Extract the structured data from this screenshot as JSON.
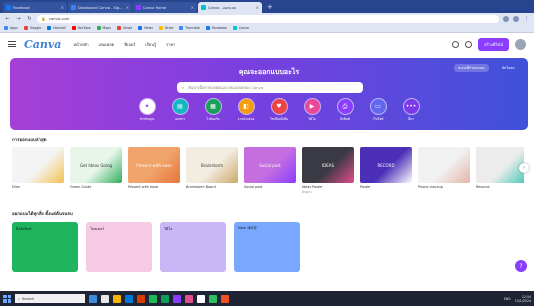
{
  "browser": {
    "tabs": [
      {
        "label": "Facebook",
        "color": "#1877f2",
        "active": false
      },
      {
        "label": "Dashboard Canva - Sign in",
        "color": "#3b82f6",
        "active": false
      },
      {
        "label": "Canva Home",
        "color": "#8b3dff",
        "active": false
      },
      {
        "label": "Canva - ออกแบบ",
        "color": "#00c4cc",
        "active": true
      }
    ],
    "address": "canva.com",
    "bookmarks": [
      {
        "label": "Apps",
        "color": "#4285f4"
      },
      {
        "label": "Google",
        "color": "#ea4335"
      },
      {
        "label": "Hotmail",
        "color": "#0078d4"
      },
      {
        "label": "YouTube",
        "color": "#ff0000"
      },
      {
        "label": "Maps",
        "color": "#34a853"
      },
      {
        "label": "Gmail",
        "color": "#ea4335"
      },
      {
        "label": "News",
        "color": "#1a73e8"
      },
      {
        "label": "Drive",
        "color": "#fbbc04"
      },
      {
        "label": "Translate",
        "color": "#4285f4"
      },
      {
        "label": "Facebook",
        "color": "#1877f2"
      },
      {
        "label": "Canva",
        "color": "#00c4cc"
      }
    ]
  },
  "canva": {
    "logo": "Canva",
    "nav": [
      "หน้าหลัก",
      "เทมเพลต",
      "ฟีเจอร์",
      "เรียนรู้",
      "ราคา"
    ],
    "create_button": "สร้างดีไซน์",
    "hero": {
      "title": "คุณจะออกแบบอะไร",
      "search_placeholder": "ค้นหาเนื้อหาของคุณและเทมเพลตของ Canva",
      "button_1": "ขนาดที่กำหนดเอง",
      "button_2": "อัปโหลด",
      "categories": [
        {
          "label": "สำหรับคุณ",
          "color": "#ffffff",
          "glyph": "✦"
        },
        {
          "label": "เอกสาร",
          "color": "#14b8c4",
          "glyph": "▤"
        },
        {
          "label": "ไวท์บอร์ด",
          "color": "#18a058",
          "glyph": "▦"
        },
        {
          "label": "งานนำเสนอ",
          "color": "#f59e0b",
          "glyph": "◧"
        },
        {
          "label": "โซเชียลมีเดีย",
          "color": "#ef4444",
          "glyph": "♥"
        },
        {
          "label": "วิดีโอ",
          "color": "#ec4899",
          "glyph": "▶"
        },
        {
          "label": "สิ่งพิมพ์",
          "color": "#8b3dff",
          "glyph": "⎙"
        },
        {
          "label": "เว็บไซต์",
          "color": "#6366f1",
          "glyph": "▭"
        },
        {
          "label": "อื่นๆ",
          "color": "#7c3aed",
          "glyph": "•••"
        }
      ]
    },
    "recent_heading": "การออกแบบล่าสุด",
    "recent": [
      {
        "title": "Ellen",
        "thumb_text": "",
        "bg": "#f4f4f4",
        "accent": "#f2c14e"
      },
      {
        "title": "Green Guide",
        "thumb_text": "Get Ideas Going",
        "bg": "#e8f6ea",
        "accent": "#2fae5d"
      },
      {
        "title": "Present with ease",
        "thumb_text": "Present with ease",
        "bg": "#f0a36a",
        "accent": "#e5773a"
      },
      {
        "title": "Brainstorm Board",
        "thumb_text": "Brainstorm",
        "bg": "#f3ece0",
        "accent": "#caa76a"
      },
      {
        "title": "Social post",
        "thumb_text": "Social post",
        "bg": "#c56ee0",
        "accent": "#8b3dff"
      },
      {
        "title": "Ideas Poster",
        "thumb_text": "IDEAS",
        "bg": "#3a3a44",
        "accent": "#e34d8c"
      },
      {
        "title": "Poster",
        "thumb_text": "RECORD",
        "bg": "#4c2fb7",
        "accent": "#ffffff"
      },
      {
        "title": "Phone mockup",
        "thumb_text": "",
        "bg": "#f1f1f1",
        "accent": "#e3b4a8"
      },
      {
        "title": "Resume",
        "thumb_text": "",
        "bg": "#ececec",
        "accent": "#3ec7b0"
      }
    ],
    "recent_subtitle": "ตัวอย่าง",
    "templates_heading": "ออกแบบได้ทุกสิ่ง ตั้งแต่ต้นจนจบ",
    "templates": [
      {
        "label": "สื่อสิ่งพิมพ์",
        "bg": "#1fb55f"
      },
      {
        "label": "โปสเตอร์",
        "bg": "#f6c9e4"
      },
      {
        "label": "วิดีโอ",
        "bg": "#c9b6f7"
      },
      {
        "label": "New 새로운",
        "bg": "#7aa7ff"
      }
    ],
    "template_extra_text": "New",
    "template_extra_text_2": "새로운"
  },
  "taskbar": {
    "search_placeholder": "Search",
    "apps": [
      "#3a8dde",
      "#e8e8e8",
      "#f5b400",
      "#0078d4",
      "#d83b01",
      "#1db954",
      "#0f9d58",
      "#8b3dff",
      "#e34d8c",
      "#ffffff",
      "#2dbe60",
      "#f25022"
    ],
    "clock_time": "12:54",
    "clock_date": "13/1/2024",
    "tray_text": "ENG"
  }
}
